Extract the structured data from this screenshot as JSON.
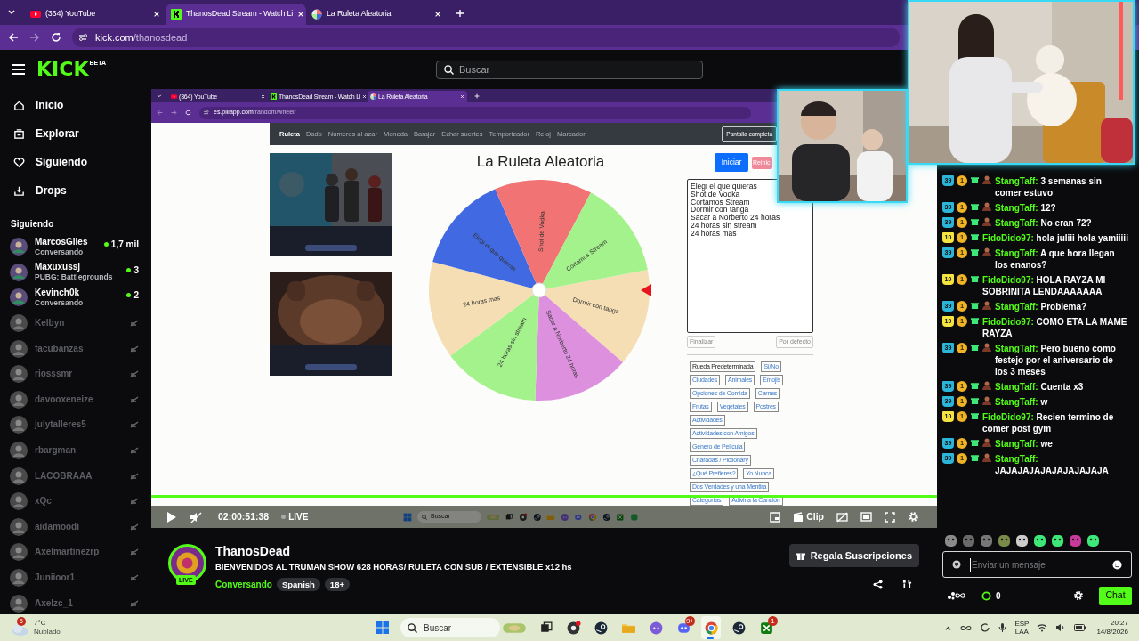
{
  "browser": {
    "tabs": [
      {
        "title": "(364) YouTube",
        "kind": "video",
        "selected": false
      },
      {
        "title": "ThanosDead Stream - Watch Li",
        "kind": "kick",
        "selected": true
      },
      {
        "title": "La Ruleta Aleatoria",
        "kind": "wheel",
        "selected": false
      }
    ],
    "address": {
      "host": "kick.com",
      "path": "/thanosdead"
    }
  },
  "header": {
    "logo": "KICK",
    "logo_badge": "BETA",
    "search": {
      "placeholder": "Buscar"
    }
  },
  "nav": [
    {
      "label": "Inicio"
    },
    {
      "label": "Explorar"
    },
    {
      "label": "Siguiendo"
    },
    {
      "label": "Drops"
    }
  ],
  "following": {
    "title": "Siguiendo",
    "channels": [
      {
        "name": "MarcosGiles",
        "category": "Conversando",
        "viewers": "1,7 mil",
        "live": true
      },
      {
        "name": "Maxuxussj",
        "category": "PUBG: Battlegrounds",
        "viewers": "3",
        "live": true
      },
      {
        "name": "Kevinch0k",
        "category": "Conversando",
        "viewers": "2",
        "live": true
      },
      {
        "name": "Kelbyn",
        "live": false
      },
      {
        "name": "facubanzas",
        "live": false
      },
      {
        "name": "riosssmr",
        "live": false
      },
      {
        "name": "davooxeneize",
        "live": false
      },
      {
        "name": "julytalleres5",
        "live": false
      },
      {
        "name": "rbargman",
        "live": false
      },
      {
        "name": "LACOBRAAA",
        "live": false
      },
      {
        "name": "xQc",
        "live": false
      },
      {
        "name": "aidamoodi",
        "live": false
      },
      {
        "name": "Axelmartinezrp",
        "live": false
      },
      {
        "name": "Juniioor1",
        "live": false
      },
      {
        "name": "Axelzc_1",
        "live": false
      }
    ]
  },
  "stream": {
    "inner_browser": {
      "tabs": [
        {
          "title": "(364) YouTube",
          "kind": "video",
          "selected": false
        },
        {
          "title": "ThanosDead Stream - Watch Li",
          "kind": "kick",
          "selected": false
        },
        {
          "title": "La Ruleta Aleatoria",
          "kind": "wheel",
          "selected": true
        }
      ],
      "address": {
        "host": "es.piliapp.com",
        "path": "/random/wheel/"
      }
    },
    "page": {
      "nav": [
        {
          "label": "Ruleta",
          "selected": true
        },
        {
          "label": "Dado",
          "selected": false
        },
        {
          "label": "Números al azar",
          "selected": false
        },
        {
          "label": "Moneda",
          "selected": false
        },
        {
          "label": "Barajar",
          "selected": false
        },
        {
          "label": "Echar suertes",
          "selected": false
        },
        {
          "label": "Temporizador",
          "selected": false
        },
        {
          "label": "Reloj",
          "selected": false
        },
        {
          "label": "Marcador",
          "selected": false
        }
      ],
      "fullscreen_button": "Pantalla completa",
      "title": "La Ruleta Aleatoria",
      "start_button": "Iniciar",
      "reset_button": "Reinic",
      "wheel": {
        "segments": [
          {
            "label": "Dormir con tanga",
            "color": "#f5deb3"
          },
          {
            "label": "Sacar a Norberto 24 horas",
            "color": "#dd90dd"
          },
          {
            "label": "24 horas sin stream",
            "color": "#a4f28c"
          },
          {
            "label": "24 horas mas",
            "color": "#f5deb3"
          },
          {
            "label": "Elegi el que quieras",
            "color": "#4169e1"
          },
          {
            "label": "Shot de Vodka",
            "color": "#f27373"
          },
          {
            "label": "Cortamos Stream",
            "color": "#a4f28c"
          }
        ]
      },
      "options": [
        "Elegi el que quieras",
        "Shot de Vodka",
        "Cortamos Stream",
        "Dormir con tanga",
        "Sacar a Norberto 24 horas",
        "24 horas sin stream",
        "24 horas mas"
      ],
      "finish_button": "Finalizar",
      "default_button": "Por defecto",
      "presets": [
        [
          {
            "label": "Rueda Predeterminada",
            "selected": true
          },
          {
            "label": "Sí/No",
            "selected": false
          }
        ],
        [
          {
            "label": "Ciudades",
            "selected": false
          },
          {
            "label": "Animales",
            "selected": false
          },
          {
            "label": "Emojis",
            "selected": false
          }
        ],
        [
          {
            "label": "Opciones de Comida",
            "selected": false
          },
          {
            "label": "Carnes",
            "selected": false
          }
        ],
        [
          {
            "label": "Frutas",
            "selected": false
          },
          {
            "label": "Vegetales",
            "selected": false
          },
          {
            "label": "Postres",
            "selected": false
          }
        ],
        [
          {
            "label": "Actividades",
            "selected": false
          }
        ],
        [
          {
            "label": "Actividades con Amigos",
            "selected": false
          }
        ],
        [
          {
            "label": "Género de Película",
            "selected": false
          }
        ],
        [
          {
            "label": "Charadas / Pictionary",
            "selected": false
          }
        ],
        [
          {
            "label": "¿Qué Prefieres?",
            "selected": false
          },
          {
            "label": "Yo Nunca",
            "selected": false
          }
        ],
        [
          {
            "label": "Dos Verdades y una Mentira",
            "selected": false
          }
        ],
        [
          {
            "label": "Categorías",
            "selected": false
          },
          {
            "label": "Adivina la Canción",
            "selected": false
          }
        ]
      ]
    },
    "inner_taskbar": {
      "search": "Buscar",
      "apps": [
        {
          "kind": "widgets"
        },
        {
          "kind": "taskview"
        },
        {
          "kind": "record"
        },
        {
          "kind": "steam"
        },
        {
          "kind": "folder"
        },
        {
          "kind": "purple"
        },
        {
          "kind": "discord"
        },
        {
          "kind": "chrome"
        },
        {
          "kind": "steam"
        },
        {
          "kind": "xbox"
        },
        {
          "kind": "green"
        }
      ]
    },
    "player": {
      "time": "02:00:51:38",
      "live": "LIVE",
      "clip": "Clip"
    }
  },
  "info": {
    "channel": "ThanosDead",
    "live_badge": "LIVE",
    "title": "BIENVENIDOS AL TRUMAN SHOW 628 HORAS/ RULETA CON SUB / EXTENSIBLE x12 hs",
    "category": "Conversando",
    "tags": [
      "Spanish",
      "18+"
    ],
    "gift_button": "Regala Suscripciones"
  },
  "chat": {
    "messages": [
      {
        "sub": {
          "text": "39",
          "color": "#2bb5d8"
        },
        "level": "1",
        "avatar": true,
        "user": "StangTaff:",
        "text": " 3 semanas sin comer estuvo"
      },
      {
        "sub": {
          "text": "39",
          "color": "#2bb5d8"
        },
        "level": "1",
        "avatar": true,
        "user": "StangTaff:",
        "text": " 12?"
      },
      {
        "sub": {
          "text": "39",
          "color": "#2bb5d8"
        },
        "level": "1",
        "avatar": true,
        "user": "StangTaff:",
        "text": " No eran 72?"
      },
      {
        "sub": {
          "text": "10",
          "color": "#f5e342"
        },
        "level": "1",
        "avatar": false,
        "user": "FidoDido97:",
        "text": " hola juliii hola yamiiiii"
      },
      {
        "sub": {
          "text": "39",
          "color": "#2bb5d8"
        },
        "level": "1",
        "avatar": true,
        "user": "StangTaff:",
        "text": " A que hora llegan los enanos?"
      },
      {
        "sub": {
          "text": "10",
          "color": "#f5e342"
        },
        "level": "1",
        "avatar": false,
        "user": "FidoDido97:",
        "text": " HOLA RAYZA MI SOBRINITA LENDAAAAAAA"
      },
      {
        "sub": {
          "text": "39",
          "color": "#2bb5d8"
        },
        "level": "1",
        "avatar": true,
        "user": "StangTaff:",
        "text": " Problema?"
      },
      {
        "sub": {
          "text": "10",
          "color": "#f5e342"
        },
        "level": "1",
        "avatar": false,
        "user": "FidoDido97:",
        "text": " COMO ETA LA MAME RAYZA"
      },
      {
        "sub": {
          "text": "39",
          "color": "#2bb5d8"
        },
        "level": "1",
        "avatar": true,
        "user": "StangTaff:",
        "text": " Pero bueno como festejo por el aniversario de los 3 meses"
      },
      {
        "sub": {
          "text": "39",
          "color": "#2bb5d8"
        },
        "level": "1",
        "avatar": true,
        "user": "StangTaff:",
        "text": " Cuenta x3"
      },
      {
        "sub": {
          "text": "39",
          "color": "#2bb5d8"
        },
        "level": "1",
        "avatar": true,
        "user": "StangTaff:",
        "text": " w"
      },
      {
        "sub": {
          "text": "10",
          "color": "#f5e342"
        },
        "level": "1",
        "avatar": false,
        "user": "FidoDido97:",
        "text": " Recien termino de comer post gym"
      },
      {
        "sub": {
          "text": "39",
          "color": "#2bb5d8"
        },
        "level": "1",
        "avatar": true,
        "user": "StangTaff:",
        "text": " we"
      },
      {
        "sub": {
          "text": "39",
          "color": "#2bb5d8"
        },
        "level": "1",
        "avatar": true,
        "user": "StangTaff:",
        "text": " JAJAJAJAJAJAJAJAJAJA"
      }
    ],
    "input": {
      "placeholder": "Enviar un mensaje"
    },
    "points": "0",
    "send_button": "Chat"
  },
  "taskbar": {
    "weather": {
      "temp": "7°C",
      "condition": "Nublado",
      "alerts": "5"
    },
    "search": {
      "placeholder": "Buscar"
    },
    "apps": [
      {
        "kind": "widgets",
        "selected": false
      },
      {
        "kind": "taskview",
        "selected": false
      },
      {
        "kind": "record",
        "selected": false
      },
      {
        "kind": "steam",
        "selected": false
      },
      {
        "kind": "folder",
        "selected": false
      },
      {
        "kind": "purple",
        "selected": false
      },
      {
        "kind": "discord",
        "badge": "9+",
        "selected": false
      },
      {
        "kind": "chrome",
        "selected": true
      },
      {
        "kind": "steam",
        "selected": false
      },
      {
        "kind": "xbox",
        "badge": "1",
        "selected": false
      }
    ],
    "tray": {
      "lang": "ESP",
      "layout": "LAA",
      "time": "20:27",
      "date": "14/8/2026"
    }
  }
}
